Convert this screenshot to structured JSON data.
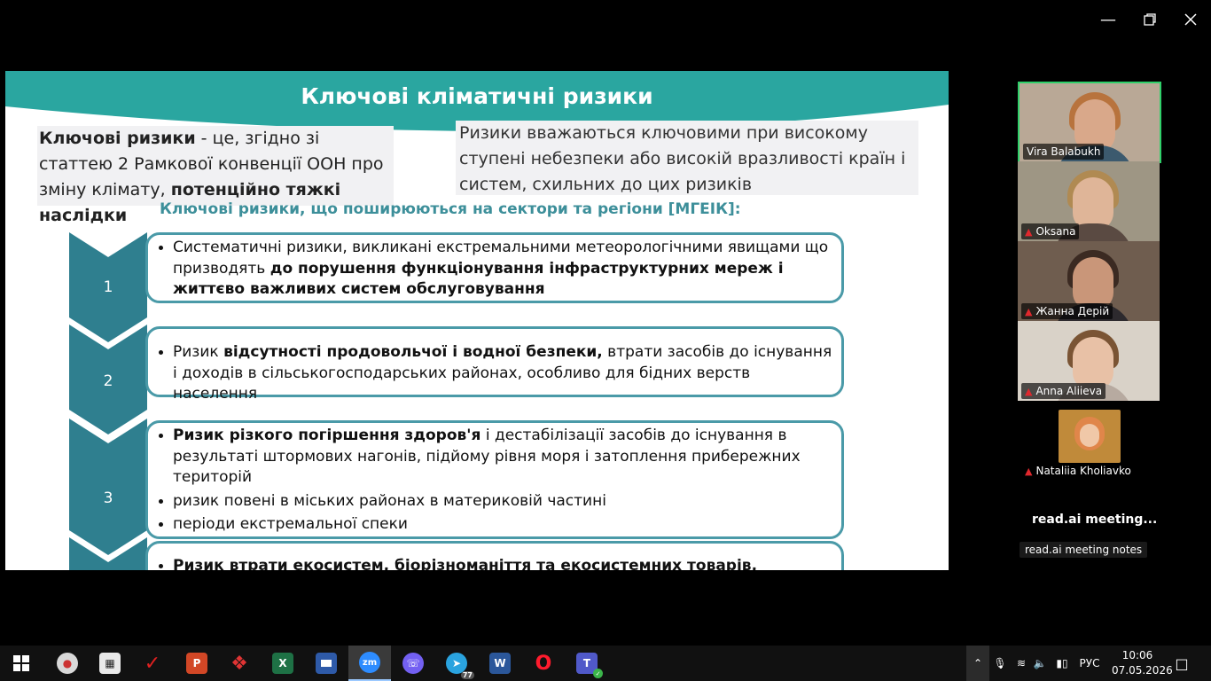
{
  "window": {
    "minimize_icon": "minimize-icon",
    "maximize_icon": "restore-icon",
    "close_icon": "close-icon"
  },
  "slide": {
    "title": "Ключові кліматичні ризики",
    "definition_left": {
      "bold1": "Ключові ризики",
      "text1": " - це, згідно зі статтею 2 Рамкової конвенції ООН про зміну клімату, ",
      "bold2": "потенційно тяжкі наслідки"
    },
    "definition_right": "Ризики вважаються ключовими при високому ступені небезпеки або високій вразливості країн і систем, схильних до цих ризиків",
    "subheading": "Ключові ризики, що поширюються на сектори та регіони [МГЕІК]:",
    "items": [
      {
        "number": "1",
        "bullets": [
          {
            "plain1": "Систематичні ризики, викликані екстремальними метеорологічними явищами що призводять ",
            "bold": "до порушення функціонування інфраструктурних мереж і життєво важливих систем обслуговування",
            "plain2": ""
          }
        ]
      },
      {
        "number": "2",
        "bullets": [
          {
            "plain1": "Ризик ",
            "bold": "відсутності продовольчої і водної безпеки,",
            "plain2": " втрати засобів до існування і доходів в сільськогосподарських районах, особливо для бідних верств населення"
          }
        ]
      },
      {
        "number": "3",
        "bullets": [
          {
            "plain1": "",
            "bold": "Ризик різкого погіршення здоров'я",
            "plain2": " і дестабілізації засобів до існування в результаті штормових нагонів, підйому рівня моря і затоплення прибережних територій"
          },
          {
            "plain1": "ризик повені в міських районах в материковій частині",
            "bold": "",
            "plain2": ""
          },
          {
            "plain1": "періоди екстремальної спеки",
            "bold": "",
            "plain2": ""
          }
        ]
      },
      {
        "number": "4",
        "bullets": [
          {
            "plain1": "",
            "bold": "Ризик втрати екосистем, біорізноманіття та екосистемних товарів, функцій і",
            "plain2": ""
          }
        ]
      }
    ]
  },
  "participants": [
    {
      "name": "Vira Balabukh",
      "muted": false,
      "active_speaker": true
    },
    {
      "name": "Oksana",
      "muted": true
    },
    {
      "name": "Жанна Дерій",
      "muted": true
    },
    {
      "name": "Anna Aliieva",
      "muted": true
    },
    {
      "name": "Nataliia Kholiavko",
      "muted": true
    }
  ],
  "readai": {
    "label": "read.ai  meeting...",
    "tag": "read.ai meeting notes"
  },
  "taskbar": {
    "apps": [
      {
        "name": "start-windows-icon"
      },
      {
        "name": "paint-icon"
      },
      {
        "name": "calculator-icon"
      },
      {
        "name": "check-app-icon"
      },
      {
        "name": "powerpoint-icon",
        "glyph": "P"
      },
      {
        "name": "anydesk-icon"
      },
      {
        "name": "excel-icon",
        "glyph": "X"
      },
      {
        "name": "save-floppy-icon"
      },
      {
        "name": "zoom-icon",
        "glyph": "zm"
      },
      {
        "name": "viber-icon"
      },
      {
        "name": "telegram-icon",
        "badge": "77"
      },
      {
        "name": "word-icon",
        "glyph": "W"
      },
      {
        "name": "opera-icon",
        "glyph": "O"
      },
      {
        "name": "teams-icon"
      }
    ],
    "language": "РУС",
    "time": "10:06",
    "date": "07.05.2026"
  },
  "colors": {
    "teal": "#2aa6a0",
    "teal_dark": "#3d8f9a",
    "chevron": "#2f7f8f",
    "card_border": "#4a9aa8",
    "active_speaker": "#2fd06a"
  }
}
